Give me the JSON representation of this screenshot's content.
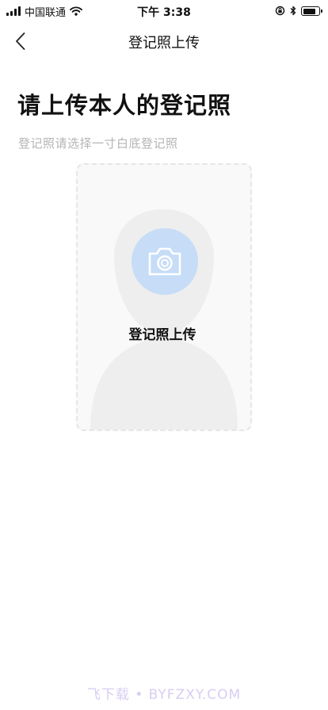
{
  "status_bar": {
    "carrier": "中国联通",
    "time": "下午 3:38",
    "battery_level": 0.85
  },
  "nav": {
    "title": "登记照上传"
  },
  "page": {
    "title": "请上传本人的登记照",
    "subtitle": "登记照请选择一寸白底登记照"
  },
  "upload": {
    "label": "登记照上传"
  },
  "watermark": "飞下载 • BYFZXY.COM",
  "colors": {
    "camera_circle": "#c6dcf7",
    "camera_icon": "#ffffff",
    "silhouette": "#eeeeee",
    "subtitle": "#b4b4b4"
  }
}
